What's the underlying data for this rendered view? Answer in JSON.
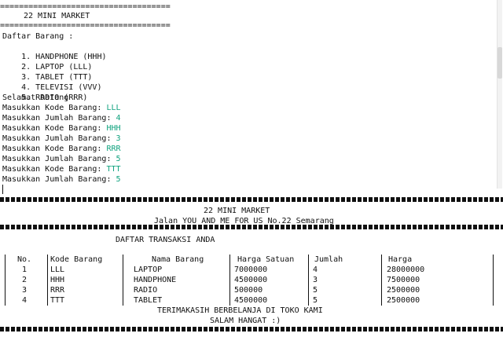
{
  "console1": {
    "sep_top": "====================================",
    "title": "22 MINI MARKET",
    "sep_title": "====================================",
    "menu_header": "Daftar Barang :",
    "menu": [
      {
        "n": "1.",
        "label": "HANDPHONE (HHH)"
      },
      {
        "n": "2.",
        "label": "LAPTOP (LLL)"
      },
      {
        "n": "3.",
        "label": "TABLET (TTT)"
      },
      {
        "n": "4.",
        "label": "TELEVISI (VVV)"
      },
      {
        "n": "5.",
        "label": "RADIO (RRR)"
      }
    ],
    "welcome": "Selamat Datang",
    "prompts": [
      {
        "prompt": "Masukkan Kode Barang: ",
        "input": "LLL"
      },
      {
        "prompt": "Masukkan Jumlah Barang: ",
        "input": "4"
      },
      {
        "prompt": "Masukkan Kode Barang: ",
        "input": "HHH"
      },
      {
        "prompt": "Masukkan Jumlah Barang: ",
        "input": "3"
      },
      {
        "prompt": "Masukkan Kode Barang: ",
        "input": "RRR"
      },
      {
        "prompt": "Masukkan Jumlah Barang: ",
        "input": "5"
      },
      {
        "prompt": "Masukkan Kode Barang: ",
        "input": "TTT"
      },
      {
        "prompt": "Masukkan Jumlah Barang: ",
        "input": "5"
      }
    ]
  },
  "receipt": {
    "store": "22 MINI MARKET",
    "address": "Jalan YOU AND ME FOR US No.22 Semarang",
    "heading": "DAFTAR TRANSAKSI ANDA",
    "headers": [
      "No.",
      "Kode Barang",
      "Nama Barang",
      "Harga Satuan",
      "Jumlah",
      "Harga"
    ],
    "rows": [
      {
        "no": "1",
        "kode": "LLL",
        "nama": "LAPTOP",
        "satuan": "7000000",
        "jumlah": "4",
        "harga": "28000000"
      },
      {
        "no": "2",
        "kode": "HHH",
        "nama": "HANDPHONE",
        "satuan": "4500000",
        "jumlah": "3",
        "harga": "7500000"
      },
      {
        "no": "3",
        "kode": "RRR",
        "nama": "RADIO",
        "satuan": "500000",
        "jumlah": "5",
        "harga": "2500000"
      },
      {
        "no": "4",
        "kode": "TTT",
        "nama": "TABLET",
        "satuan": "4500000",
        "jumlah": "5",
        "harga": "2500000"
      }
    ],
    "thanks": "TERIMAKASIH BERBELANJA DI TOKO KAMI",
    "greeting": "SALAM HANGAT :)"
  }
}
